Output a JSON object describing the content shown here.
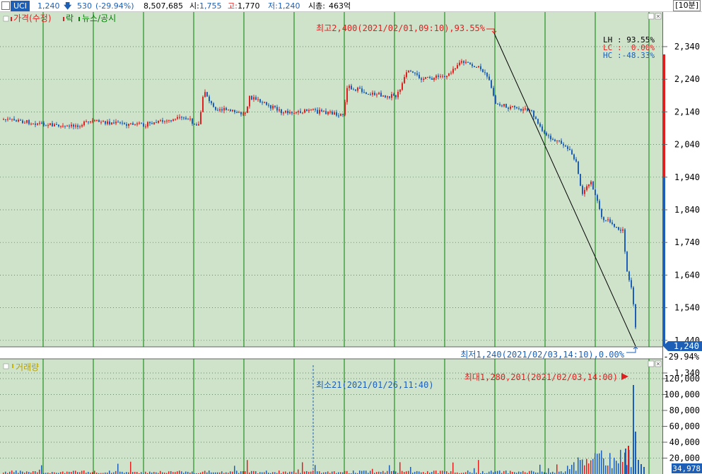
{
  "header": {
    "symbol": "UCI",
    "price": "1,240",
    "change_arrow": "down-arrow-icon",
    "change": "530",
    "change_pct": "(-29.94%)",
    "volume": "8,507,685",
    "open_label": "시:",
    "open": "1,755",
    "high_label": "고:",
    "high": "1,770",
    "low_label": "저:",
    "low": "1,240",
    "mcap_label": "시총:",
    "mcap": "463억",
    "period": "[10분]"
  },
  "price_panel": {
    "legend": [
      "가격(수정)",
      "락",
      "뉴스/공시"
    ],
    "legend_colors": [
      "#e02020",
      "#e02020",
      "#008000"
    ],
    "high_annot": "최고2,400(2021/02/01,09:10),93.55%",
    "low_annot": "최저1,240(2021/02/03,14:10),0.00%",
    "stats": [
      {
        "label": "LH",
        "value": "93.55%",
        "color": "#000000"
      },
      {
        "label": "LC",
        "value": "0.00%",
        "color": "#e02020"
      },
      {
        "label": "HC",
        "value": "-48.33%",
        "color": "#1d5fb6"
      }
    ],
    "y_ticks": [
      "2,340",
      "2,240",
      "2,140",
      "2,040",
      "1,940",
      "1,840",
      "1,740",
      "1,640",
      "1,540",
      "1,440",
      "1,340"
    ],
    "current_price": "1,240",
    "current_pct": "-29.94%"
  },
  "volume_panel": {
    "legend": "거래량",
    "min_annot": "최소21(2021/01/26,11:40)",
    "max_annot": "최대1,280,201(2021/02/03,14:00)",
    "y_ticks": [
      "120,000",
      "100,000",
      "80,000",
      "60,000",
      "40,000",
      "20,000"
    ],
    "current_volume": "34,978"
  },
  "colors": {
    "plot_bg": "#cfe3cb",
    "up": "#e02020",
    "down": "#1d5fb6",
    "day_line": "#008000"
  }
}
